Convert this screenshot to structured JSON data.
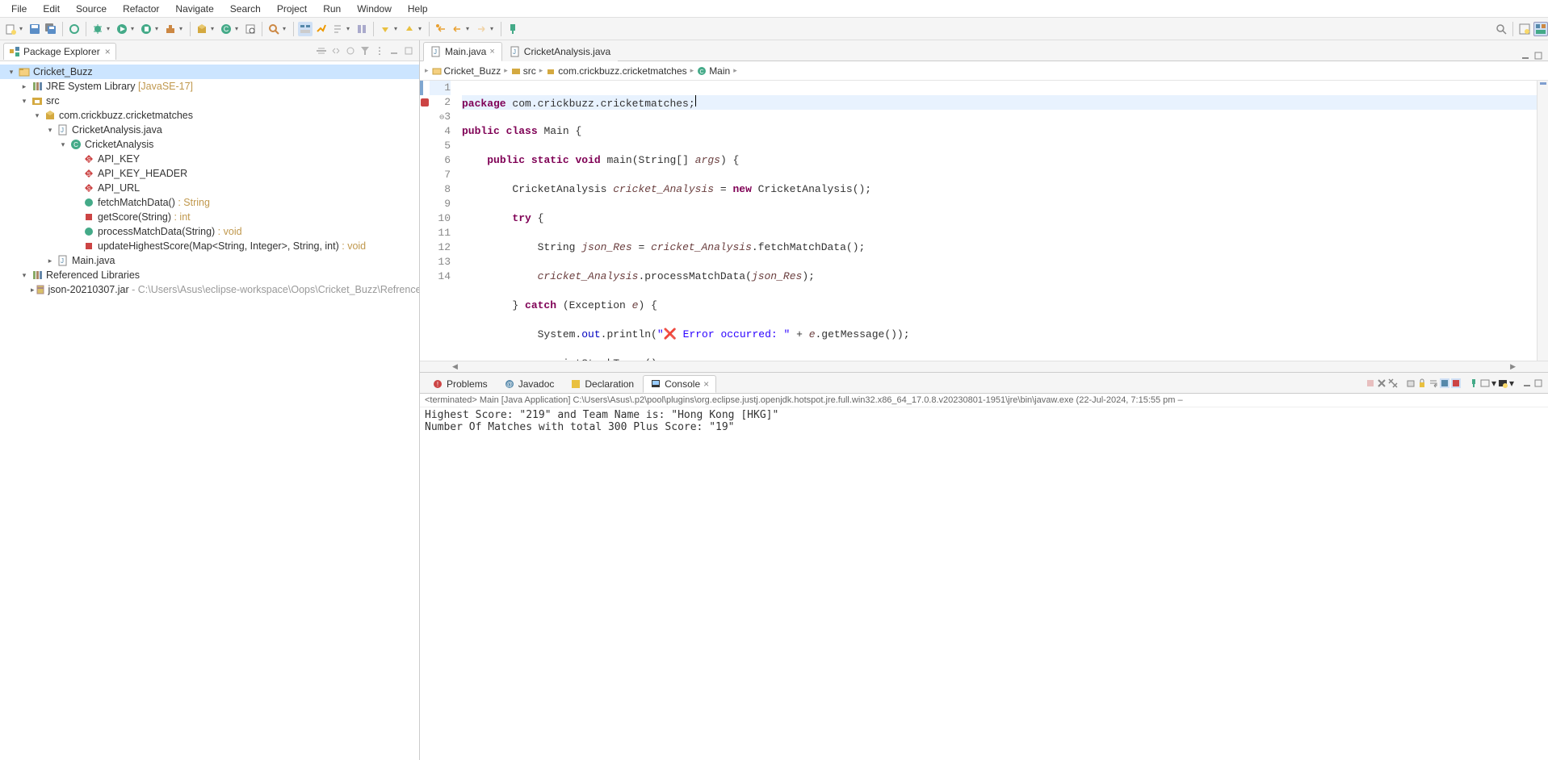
{
  "menu": {
    "items": [
      "File",
      "Edit",
      "Source",
      "Refactor",
      "Navigate",
      "Search",
      "Project",
      "Run",
      "Window",
      "Help"
    ]
  },
  "package_explorer": {
    "title": "Package Explorer",
    "tree": {
      "project": "Cricket_Buzz",
      "jre": "JRE System Library",
      "jre_ver": "[JavaSE-17]",
      "src": "src",
      "pkg": "com.crickbuzz.cricketmatches",
      "file1": "CricketAnalysis.java",
      "cls1": "CricketAnalysis",
      "m1": "API_KEY",
      "m2": "API_KEY_HEADER",
      "m3": "API_URL",
      "m4a": "fetchMatchData()",
      "m4b": " : String",
      "m5a": "getScore(String)",
      "m5b": " : int",
      "m6a": "processMatchData(String)",
      "m6b": " : void",
      "m7a": "updateHighestScore(Map<String, Integer>, String, int)",
      "m7b": " : void",
      "file2": "Main.java",
      "reflib": "Referenced Libraries",
      "jar": "json-20210307.jar",
      "jarpath": " - C:\\Users\\Asus\\eclipse-workspace\\Oops\\Cricket_Buzz\\Refrenced"
    }
  },
  "editor": {
    "tabs": [
      {
        "name": "Main.java",
        "active": true
      },
      {
        "name": "CricketAnalysis.java",
        "active": false
      }
    ],
    "breadcrumb": {
      "b1": "Cricket_Buzz",
      "b2": "src",
      "b3": "com.crickbuzz.cricketmatches",
      "b4": "Main"
    },
    "lines": [
      "1",
      "2",
      "3",
      "4",
      "5",
      "6",
      "7",
      "8",
      "9",
      "10",
      "11",
      "12",
      "13",
      "14"
    ]
  },
  "console": {
    "tabs": {
      "problems": "Problems",
      "javadoc": "Javadoc",
      "decl": "Declaration",
      "console": "Console"
    },
    "info": "<terminated> Main [Java Application] C:\\Users\\Asus\\.p2\\pool\\plugins\\org.eclipse.justj.openjdk.hotspot.jre.full.win32.x86_64_17.0.8.v20230801-1951\\jre\\bin\\javaw.exe  (22-Jul-2024, 7:15:55 pm –",
    "out": "Highest Score: \"219\" and Team Name is: \"Hong Kong [HKG]\"\nNumber Of Matches with total 300 Plus Score: \"19\""
  }
}
